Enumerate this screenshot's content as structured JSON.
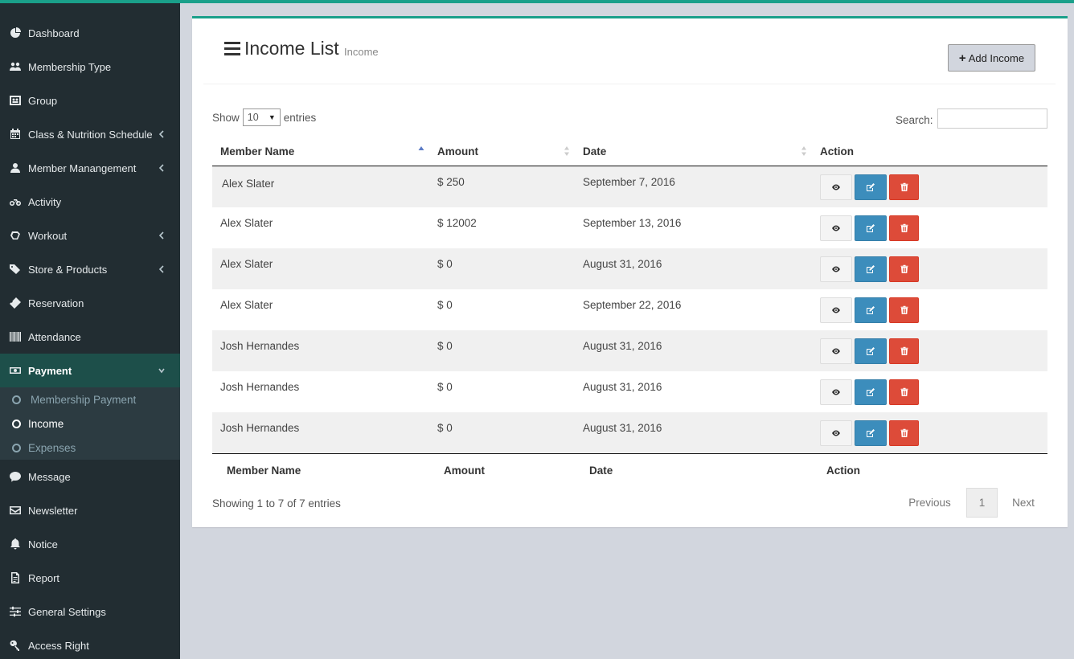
{
  "sidebar": {
    "items": [
      {
        "label": "Dashboard",
        "icon": "dashboard-icon"
      },
      {
        "label": "Membership Type",
        "icon": "users-icon"
      },
      {
        "label": "Group",
        "icon": "group-icon"
      },
      {
        "label": "Class & Nutrition Schedule",
        "icon": "calendar-icon"
      },
      {
        "label": "Member Manangement",
        "icon": "user-icon"
      },
      {
        "label": "Activity",
        "icon": "bicycle-icon"
      },
      {
        "label": "Workout",
        "icon": "workout-icon"
      },
      {
        "label": "Store & Products",
        "icon": "tags-icon"
      },
      {
        "label": "Reservation",
        "icon": "ticket-icon"
      },
      {
        "label": "Attendance",
        "icon": "barcode-icon"
      },
      {
        "label": "Payment",
        "icon": "money-icon"
      },
      {
        "label": "Message",
        "icon": "comment-icon"
      },
      {
        "label": "Newsletter",
        "icon": "envelope-icon"
      },
      {
        "label": "Notice",
        "icon": "bell-icon"
      },
      {
        "label": "Report",
        "icon": "report-icon"
      },
      {
        "label": "General Settings",
        "icon": "sliders-icon"
      },
      {
        "label": "Access Right",
        "icon": "key-icon"
      }
    ],
    "payment_submenu": [
      {
        "label": "Membership Payment"
      },
      {
        "label": "Income"
      },
      {
        "label": "Expenses"
      }
    ]
  },
  "header": {
    "title": "Income List",
    "subtitle": "Income",
    "add_button": "Add Income"
  },
  "table_controls": {
    "show_label": "Show",
    "entries_label": "entries",
    "page_length": "10",
    "search_label": "Search:"
  },
  "table": {
    "columns": [
      "Member Name",
      "Amount",
      "Date",
      "Action"
    ],
    "rows": [
      {
        "name": "Alex Slater",
        "amount": "$ 250",
        "date": "September 7, 2016"
      },
      {
        "name": "Alex Slater",
        "amount": "$ 12002",
        "date": "September 13, 2016"
      },
      {
        "name": "Alex Slater",
        "amount": "$ 0",
        "date": "August 31, 2016"
      },
      {
        "name": "Alex Slater",
        "amount": "$ 0",
        "date": "September 22, 2016"
      },
      {
        "name": "Josh Hernandes",
        "amount": "$ 0",
        "date": "August 31, 2016"
      },
      {
        "name": "Josh Hernandes",
        "amount": "$ 0",
        "date": "August 31, 2016"
      },
      {
        "name": "Josh Hernandes",
        "amount": "$ 0",
        "date": "August 31, 2016"
      }
    ]
  },
  "footer": {
    "info": "Showing 1 to 7 of 7 entries",
    "previous": "Previous",
    "page": "1",
    "next": "Next"
  },
  "colors": {
    "accent": "#1aa08a",
    "sidebar_bg": "#222d32",
    "active_bg": "#1d4f4a",
    "edit": "#3c8dbc",
    "delete": "#dd4b39"
  }
}
